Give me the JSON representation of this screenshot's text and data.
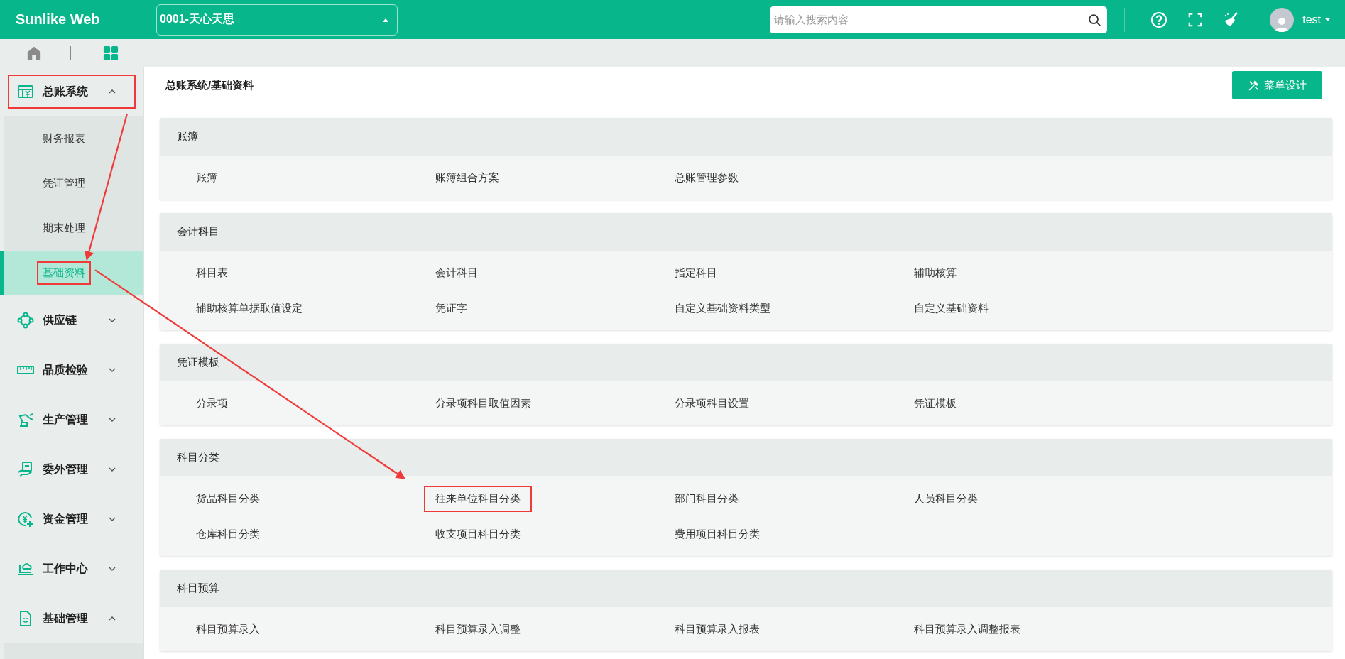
{
  "app": {
    "logo": "Sunlike Web"
  },
  "company_select": {
    "value": "0001-天心天思"
  },
  "search": {
    "placeholder": "请输入搜索内容"
  },
  "user": {
    "name": "test"
  },
  "breadcrumb": "总账系统/基础资料",
  "menu_design_button": "菜单设计",
  "sidebar": {
    "items": [
      {
        "label": "总账系统",
        "expanded": true,
        "highlighted": true,
        "children": [
          {
            "label": "财务报表",
            "selected": false,
            "highlighted": false
          },
          {
            "label": "凭证管理",
            "selected": false,
            "highlighted": false
          },
          {
            "label": "期末处理",
            "selected": false,
            "highlighted": false
          },
          {
            "label": "基础资料",
            "selected": true,
            "highlighted": true
          }
        ]
      },
      {
        "label": "供应链",
        "expanded": false,
        "highlighted": false
      },
      {
        "label": "品质检验",
        "expanded": false,
        "highlighted": false
      },
      {
        "label": "生产管理",
        "expanded": false,
        "highlighted": false
      },
      {
        "label": "委外管理",
        "expanded": false,
        "highlighted": false
      },
      {
        "label": "资金管理",
        "expanded": false,
        "highlighted": false
      },
      {
        "label": "工作中心",
        "expanded": false,
        "highlighted": false
      },
      {
        "label": "基础管理",
        "expanded": true,
        "highlighted": false
      }
    ]
  },
  "sections": [
    {
      "title": "账簿",
      "items": [
        {
          "label": "账簿",
          "highlighted": false
        },
        {
          "label": "账簿组合方案",
          "highlighted": false
        },
        {
          "label": "总账管理参数",
          "highlighted": false
        }
      ]
    },
    {
      "title": "会计科目",
      "items": [
        {
          "label": "科目表",
          "highlighted": false
        },
        {
          "label": "会计科目",
          "highlighted": false
        },
        {
          "label": "指定科目",
          "highlighted": false
        },
        {
          "label": "辅助核算",
          "highlighted": false
        },
        {
          "label": "辅助核算单据取值设定",
          "highlighted": false
        },
        {
          "label": "凭证字",
          "highlighted": false
        },
        {
          "label": "自定义基础资料类型",
          "highlighted": false
        },
        {
          "label": "自定义基础资料",
          "highlighted": false
        }
      ]
    },
    {
      "title": "凭证模板",
      "items": [
        {
          "label": "分录项",
          "highlighted": false
        },
        {
          "label": "分录项科目取值因素",
          "highlighted": false
        },
        {
          "label": "分录项科目设置",
          "highlighted": false
        },
        {
          "label": "凭证模板",
          "highlighted": false
        }
      ]
    },
    {
      "title": "科目分类",
      "items": [
        {
          "label": "货品科目分类",
          "highlighted": false
        },
        {
          "label": "往来单位科目分类",
          "highlighted": true
        },
        {
          "label": "部门科目分类",
          "highlighted": false
        },
        {
          "label": "人员科目分类",
          "highlighted": false
        },
        {
          "label": "仓库科目分类",
          "highlighted": false
        },
        {
          "label": "收支项目科目分类",
          "highlighted": false
        },
        {
          "label": "费用项目科目分类",
          "highlighted": false
        }
      ]
    },
    {
      "title": "科目预算",
      "items": [
        {
          "label": "科目预算录入",
          "highlighted": false
        },
        {
          "label": "科目预算录入调整",
          "highlighted": false
        },
        {
          "label": "科目预算录入报表",
          "highlighted": false
        },
        {
          "label": "科目预算录入调整报表",
          "highlighted": false
        }
      ]
    }
  ]
}
